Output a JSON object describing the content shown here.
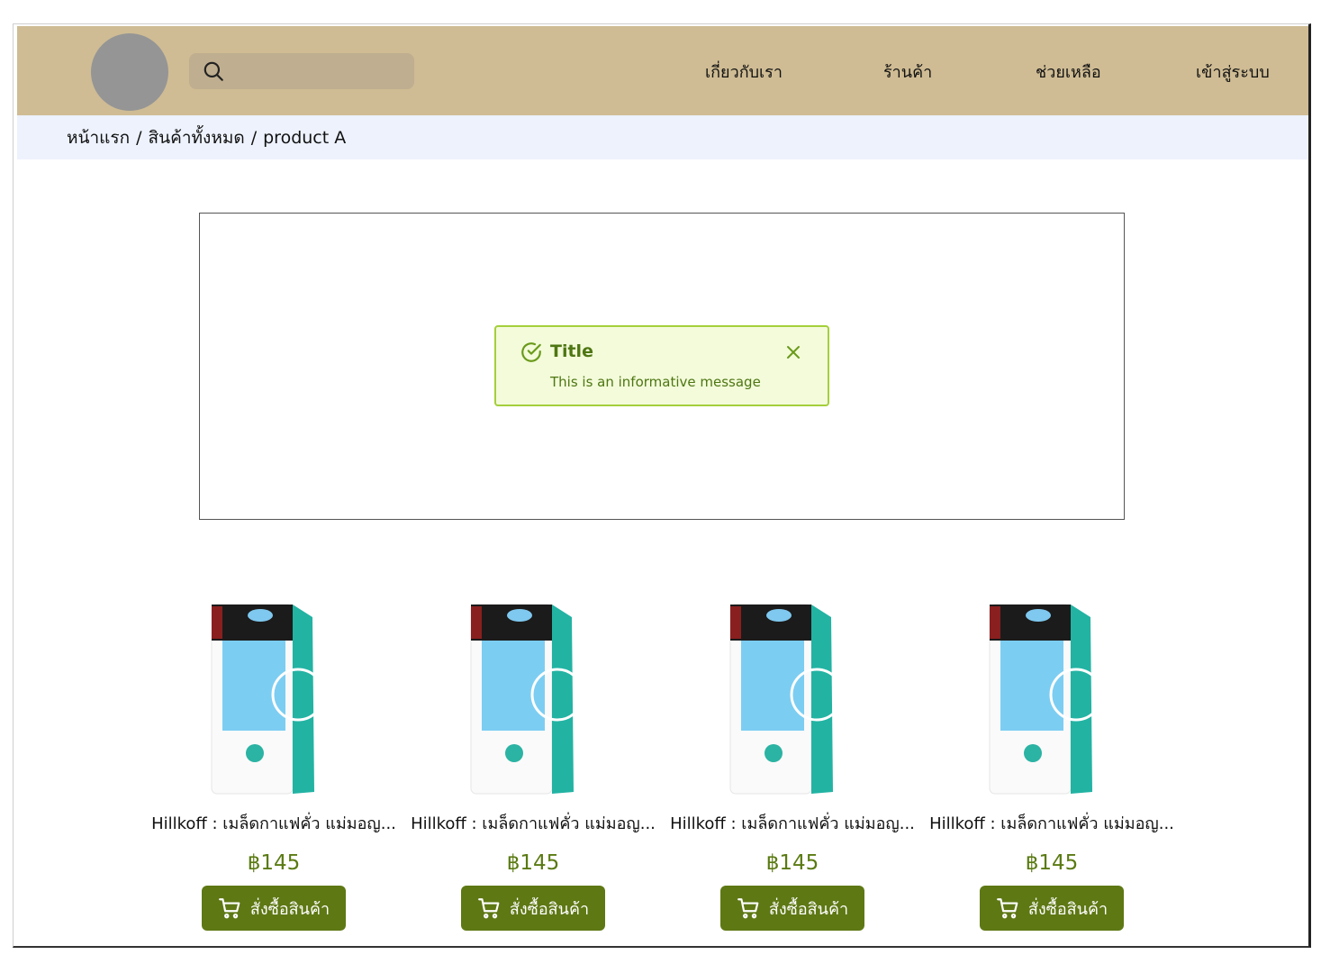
{
  "header": {
    "nav": [
      "เกี่ยวกับเรา",
      "ร้านค้า",
      "ช่วยเหลือ",
      "เข้าสู่ระบบ"
    ]
  },
  "breadcrumb": [
    "หน้าแรก",
    "สินค้าทั้งหมด",
    "product A"
  ],
  "alert": {
    "title": "Title",
    "message": "This is an informative message"
  },
  "products": [
    {
      "name": "Hillkoff : เมล็ดกาแฟคั่ว แม่มอญ...",
      "price": "฿145",
      "button": "สั่งซื้อสินค้า"
    },
    {
      "name": "Hillkoff : เมล็ดกาแฟคั่ว แม่มอญ...",
      "price": "฿145",
      "button": "สั่งซื้อสินค้า"
    },
    {
      "name": "Hillkoff : เมล็ดกาแฟคั่ว แม่มอญ...",
      "price": "฿145",
      "button": "สั่งซื้อสินค้า"
    },
    {
      "name": "Hillkoff : เมล็ดกาแฟคั่ว แม่มอญ...",
      "price": "฿145",
      "button": "สั่งซื้อสินค้า"
    }
  ],
  "colors": {
    "header_bg": "#cfbc94",
    "breadcrumb_bg": "#edf2fd",
    "alert_border": "#a4cf3b",
    "alert_bg": "#f3fbda",
    "button_bg": "#5e7814",
    "price": "#5a7a12"
  },
  "icons": {
    "search": "search-icon",
    "alert": "check-circle-icon",
    "close": "close-icon",
    "cart": "cart-icon"
  }
}
